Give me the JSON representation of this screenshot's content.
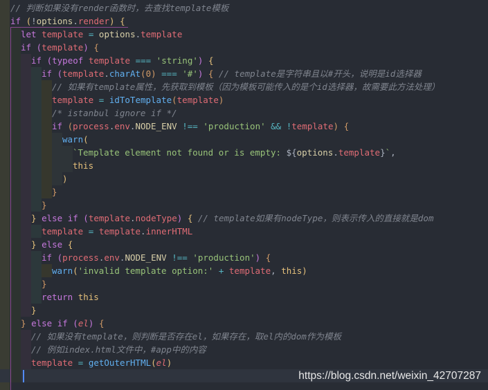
{
  "code": {
    "lines": [
      {
        "indent": 0,
        "tokens": [
          [
            "cm",
            "// 判断如果没有render函数时，去查找template模板"
          ]
        ]
      },
      {
        "indent": 0,
        "tokens": [
          [
            "kw",
            "if"
          ],
          [
            "p",
            " "
          ],
          [
            "b1",
            "("
          ],
          [
            "p",
            "!"
          ],
          [
            "obj",
            "options"
          ],
          [
            "p",
            "."
          ],
          [
            "prop",
            "render"
          ],
          [
            "b1",
            ")"
          ],
          [
            "p",
            " "
          ],
          [
            "b1",
            "{"
          ]
        ]
      },
      {
        "indent": 1,
        "tokens": [
          [
            "kw",
            "let"
          ],
          [
            "p",
            " "
          ],
          [
            "var",
            "template"
          ],
          [
            "p",
            " "
          ],
          [
            "op",
            "="
          ],
          [
            "p",
            " "
          ],
          [
            "obj",
            "options"
          ],
          [
            "p",
            "."
          ],
          [
            "prop",
            "template"
          ]
        ]
      },
      {
        "indent": 1,
        "tokens": [
          [
            "kw",
            "if"
          ],
          [
            "p",
            " "
          ],
          [
            "b2",
            "("
          ],
          [
            "var",
            "template"
          ],
          [
            "b2",
            ")"
          ],
          [
            "p",
            " "
          ],
          [
            "b3",
            "{"
          ]
        ]
      },
      {
        "indent": 2,
        "tokens": [
          [
            "kw",
            "if"
          ],
          [
            "p",
            " "
          ],
          [
            "b2",
            "("
          ],
          [
            "kw",
            "typeof"
          ],
          [
            "p",
            " "
          ],
          [
            "var",
            "template"
          ],
          [
            "p",
            " "
          ],
          [
            "op",
            "==="
          ],
          [
            "p",
            " "
          ],
          [
            "str",
            "'string'"
          ],
          [
            "b2",
            ")"
          ],
          [
            "p",
            " "
          ],
          [
            "b1",
            "{"
          ]
        ]
      },
      {
        "indent": 3,
        "tokens": [
          [
            "kw",
            "if"
          ],
          [
            "p",
            " "
          ],
          [
            "b2",
            "("
          ],
          [
            "var",
            "template"
          ],
          [
            "p",
            "."
          ],
          [
            "fn",
            "charAt"
          ],
          [
            "b3",
            "("
          ],
          [
            "num",
            "0"
          ],
          [
            "b3",
            ")"
          ],
          [
            "p",
            " "
          ],
          [
            "op",
            "==="
          ],
          [
            "p",
            " "
          ],
          [
            "str",
            "'#'"
          ],
          [
            "b2",
            ")"
          ],
          [
            "p",
            " "
          ],
          [
            "b3",
            "{"
          ],
          [
            "p",
            " "
          ],
          [
            "cm",
            "// template是字符串且以#开头，说明是id选择器"
          ]
        ]
      },
      {
        "indent": 4,
        "tokens": [
          [
            "cm",
            "// 如果有template属性，先获取到模板（因为模板可能传入的是个id选择器，故需要此方法处理）"
          ]
        ]
      },
      {
        "indent": 4,
        "tokens": [
          [
            "var",
            "template"
          ],
          [
            "p",
            " "
          ],
          [
            "op",
            "="
          ],
          [
            "p",
            " "
          ],
          [
            "fn",
            "idToTemplate"
          ],
          [
            "b3",
            "("
          ],
          [
            "var",
            "template"
          ],
          [
            "b3",
            ")"
          ]
        ]
      },
      {
        "indent": 4,
        "tokens": [
          [
            "cm",
            "/* istanbul ignore if */"
          ]
        ]
      },
      {
        "indent": 4,
        "tokens": [
          [
            "kw",
            "if"
          ],
          [
            "p",
            " "
          ],
          [
            "b3",
            "("
          ],
          [
            "var",
            "process"
          ],
          [
            "p",
            "."
          ],
          [
            "prop",
            "env"
          ],
          [
            "p",
            "."
          ],
          [
            "obj",
            "NODE_ENV"
          ],
          [
            "p",
            " "
          ],
          [
            "op",
            "!=="
          ],
          [
            "p",
            " "
          ],
          [
            "str",
            "'production'"
          ],
          [
            "p",
            " "
          ],
          [
            "op",
            "&&"
          ],
          [
            "p",
            " "
          ],
          [
            "op",
            "!"
          ],
          [
            "var",
            "template"
          ],
          [
            "b3",
            ")"
          ],
          [
            "p",
            " "
          ],
          [
            "b3",
            "{"
          ]
        ]
      },
      {
        "indent": 5,
        "tokens": [
          [
            "fn",
            "warn"
          ],
          [
            "b1",
            "("
          ]
        ]
      },
      {
        "indent": 6,
        "tokens": [
          [
            "str",
            "`Template element not found or is empty: "
          ],
          [
            "p",
            "${"
          ],
          [
            "obj",
            "options"
          ],
          [
            "p",
            "."
          ],
          [
            "prop",
            "template"
          ],
          [
            "p",
            "}"
          ],
          [
            "str",
            "`"
          ],
          [
            "p",
            ","
          ]
        ]
      },
      {
        "indent": 6,
        "tokens": [
          [
            "b1",
            "this"
          ]
        ]
      },
      {
        "indent": 5,
        "tokens": [
          [
            "b1",
            ")"
          ]
        ]
      },
      {
        "indent": 4,
        "tokens": [
          [
            "b3",
            "}"
          ]
        ]
      },
      {
        "indent": 3,
        "tokens": [
          [
            "b3",
            "}"
          ]
        ]
      },
      {
        "indent": 2,
        "tokens": [
          [
            "b1",
            "}"
          ],
          [
            "p",
            " "
          ],
          [
            "kw",
            "else if"
          ],
          [
            "p",
            " "
          ],
          [
            "b2",
            "("
          ],
          [
            "var",
            "template"
          ],
          [
            "p",
            "."
          ],
          [
            "prop",
            "nodeType"
          ],
          [
            "b2",
            ")"
          ],
          [
            "p",
            " "
          ],
          [
            "b1",
            "{"
          ],
          [
            "p",
            " "
          ],
          [
            "cm",
            "// template如果有nodeType，则表示传入的直接就是dom"
          ]
        ]
      },
      {
        "indent": 3,
        "tokens": [
          [
            "var",
            "template"
          ],
          [
            "p",
            " "
          ],
          [
            "op",
            "="
          ],
          [
            "p",
            " "
          ],
          [
            "var",
            "template"
          ],
          [
            "p",
            "."
          ],
          [
            "prop",
            "innerHTML"
          ]
        ]
      },
      {
        "indent": 2,
        "tokens": [
          [
            "b1",
            "}"
          ],
          [
            "p",
            " "
          ],
          [
            "kw",
            "else"
          ],
          [
            "p",
            " "
          ],
          [
            "b1",
            "{"
          ]
        ]
      },
      {
        "indent": 3,
        "tokens": [
          [
            "kw",
            "if"
          ],
          [
            "p",
            " "
          ],
          [
            "b2",
            "("
          ],
          [
            "var",
            "process"
          ],
          [
            "p",
            "."
          ],
          [
            "prop",
            "env"
          ],
          [
            "p",
            "."
          ],
          [
            "obj",
            "NODE_ENV"
          ],
          [
            "p",
            " "
          ],
          [
            "op",
            "!=="
          ],
          [
            "p",
            " "
          ],
          [
            "str",
            "'production'"
          ],
          [
            "b2",
            ")"
          ],
          [
            "p",
            " "
          ],
          [
            "b3",
            "{"
          ]
        ]
      },
      {
        "indent": 4,
        "tokens": [
          [
            "fn",
            "warn"
          ],
          [
            "b1",
            "("
          ],
          [
            "str",
            "'invalid template option:'"
          ],
          [
            "p",
            " "
          ],
          [
            "op",
            "+"
          ],
          [
            "p",
            " "
          ],
          [
            "var",
            "template"
          ],
          [
            "p",
            ", "
          ],
          [
            "b1",
            "this"
          ],
          [
            "b1",
            ")"
          ]
        ]
      },
      {
        "indent": 3,
        "tokens": [
          [
            "b3",
            "}"
          ]
        ]
      },
      {
        "indent": 3,
        "tokens": [
          [
            "kw",
            "return"
          ],
          [
            "p",
            " "
          ],
          [
            "b1",
            "this"
          ]
        ]
      },
      {
        "indent": 2,
        "tokens": [
          [
            "b1",
            "}"
          ]
        ]
      },
      {
        "indent": 1,
        "tokens": [
          [
            "b3",
            "}"
          ],
          [
            "p",
            " "
          ],
          [
            "kw",
            "else if"
          ],
          [
            "p",
            " "
          ],
          [
            "b2",
            "("
          ],
          [
            "it",
            "el"
          ],
          [
            "b2",
            ")"
          ],
          [
            "p",
            " "
          ],
          [
            "b3",
            "{"
          ]
        ]
      },
      {
        "indent": 2,
        "tokens": [
          [
            "cm",
            "// 如果没有template，则判断是否存在el，如果存在，取el内的dom作为模板"
          ]
        ]
      },
      {
        "indent": 2,
        "tokens": [
          [
            "cm",
            "// 例如index.html文件中，#app中的内容"
          ]
        ]
      },
      {
        "indent": 2,
        "tokens": [
          [
            "var",
            "template"
          ],
          [
            "p",
            " "
          ],
          [
            "op",
            "="
          ],
          [
            "p",
            " "
          ],
          [
            "fn",
            "getOuterHTML"
          ],
          [
            "b1",
            "("
          ],
          [
            "it",
            "el"
          ],
          [
            "b1",
            ")"
          ]
        ]
      },
      {
        "indent": 1,
        "current": true,
        "tokens": [
          [
            "b3",
            ""
          ]
        ]
      }
    ]
  },
  "watermark": "https://blog.csdn.net/weixin_42707287"
}
